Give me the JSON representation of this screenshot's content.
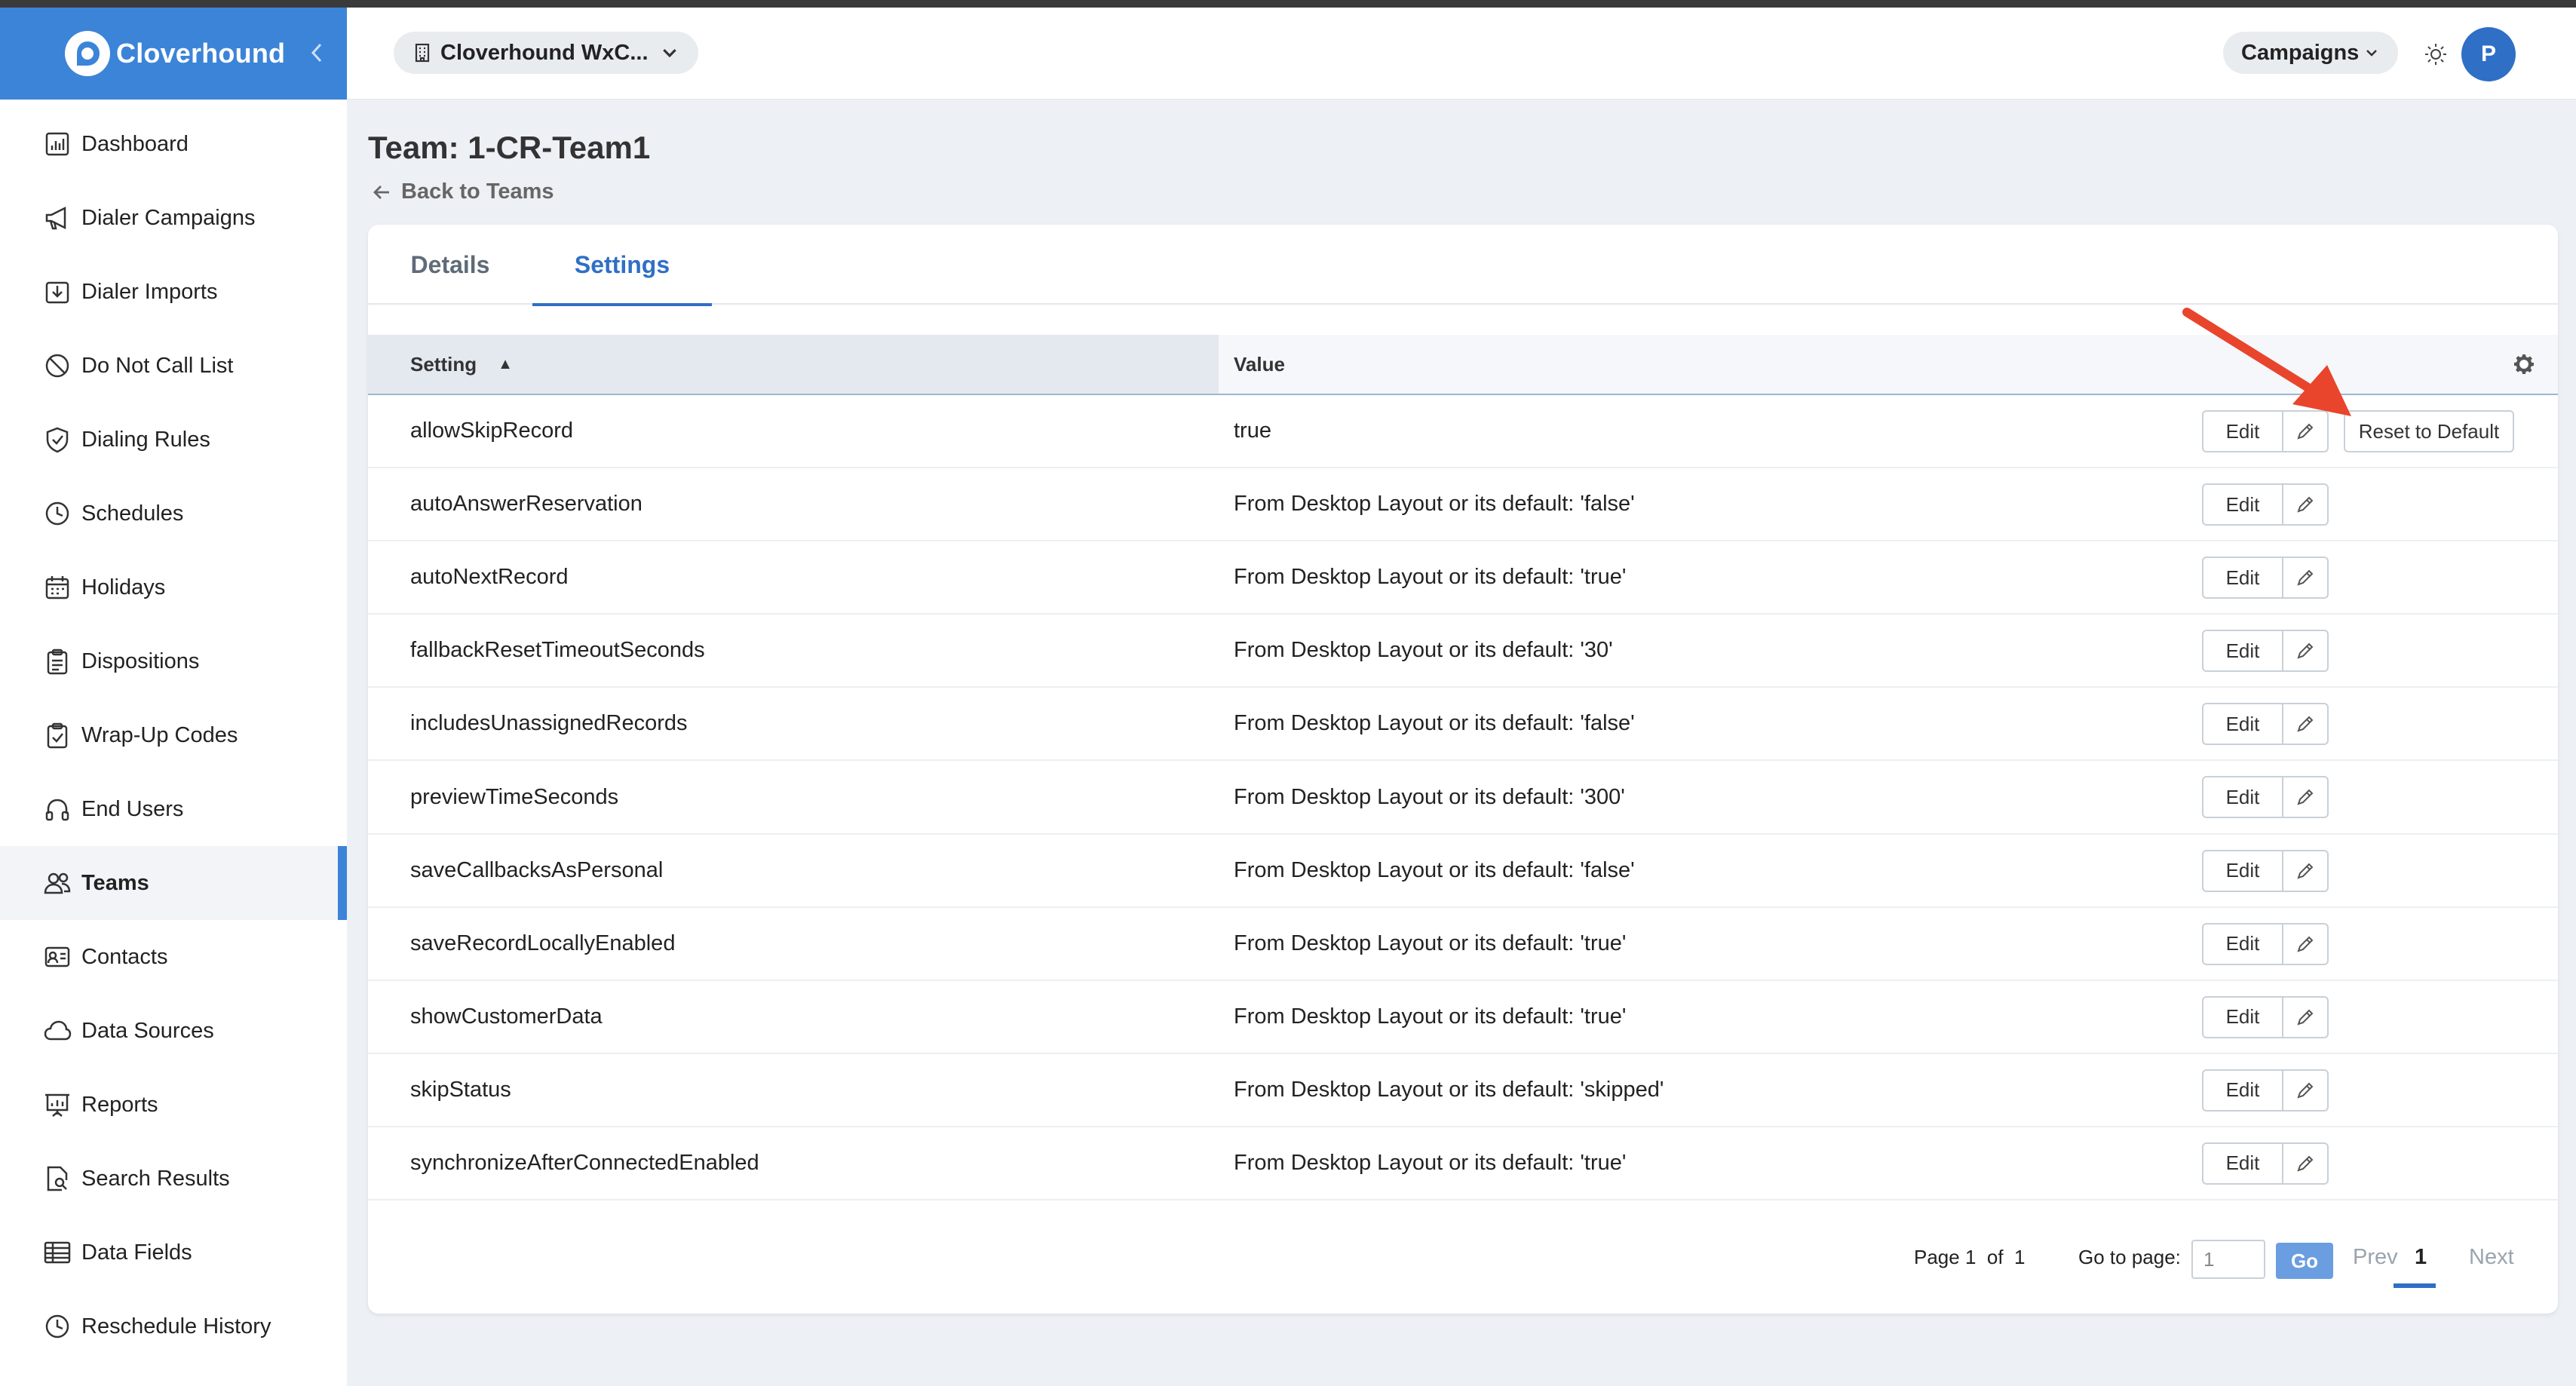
{
  "brand": {
    "name": "Cloverhound",
    "logo_icon": "clover-logo-icon",
    "color": "#3c84d8"
  },
  "sidebar": {
    "items": [
      {
        "label": "Dashboard",
        "icon": "chart-icon"
      },
      {
        "label": "Dialer Campaigns",
        "icon": "megaphone-icon"
      },
      {
        "label": "Dialer Imports",
        "icon": "import-icon"
      },
      {
        "label": "Do Not Call List",
        "icon": "ban-icon"
      },
      {
        "label": "Dialing Rules",
        "icon": "shield-check-icon"
      },
      {
        "label": "Schedules",
        "icon": "clock-icon"
      },
      {
        "label": "Holidays",
        "icon": "calendar-icon"
      },
      {
        "label": "Dispositions",
        "icon": "clipboard-icon"
      },
      {
        "label": "Wrap-Up Codes",
        "icon": "clipboard-check-icon"
      },
      {
        "label": "End Users",
        "icon": "headset-icon"
      },
      {
        "label": "Teams",
        "icon": "users-icon",
        "active": true
      },
      {
        "label": "Contacts",
        "icon": "contact-card-icon"
      },
      {
        "label": "Data Sources",
        "icon": "cloud-icon"
      },
      {
        "label": "Reports",
        "icon": "presentation-icon"
      },
      {
        "label": "Search Results",
        "icon": "search-doc-icon"
      },
      {
        "label": "Data Fields",
        "icon": "table-icon"
      },
      {
        "label": "Reschedule History",
        "icon": "clock-icon"
      }
    ]
  },
  "header": {
    "org_label": "Cloverhound WxC...",
    "campaigns_label": "Campaigns",
    "avatar_initial": "P"
  },
  "page": {
    "title": "Team: 1-CR-Team1",
    "back_label": "Back to Teams"
  },
  "tabs": [
    {
      "label": "Details",
      "active": false
    },
    {
      "label": "Settings",
      "active": true
    }
  ],
  "table": {
    "headers": {
      "setting": "Setting",
      "value": "Value",
      "sort_indicator": "▲"
    },
    "edit_label": "Edit",
    "reset_label": "Reset to Default",
    "rows": [
      {
        "setting": "allowSkipRecord",
        "value": "true",
        "has_reset": true
      },
      {
        "setting": "autoAnswerReservation",
        "value": "From Desktop Layout or its default: 'false'"
      },
      {
        "setting": "autoNextRecord",
        "value": "From Desktop Layout or its default: 'true'"
      },
      {
        "setting": "fallbackResetTimeoutSeconds",
        "value": "From Desktop Layout or its default: '30'"
      },
      {
        "setting": "includesUnassignedRecords",
        "value": "From Desktop Layout or its default: 'false'"
      },
      {
        "setting": "previewTimeSeconds",
        "value": "From Desktop Layout or its default: '300'"
      },
      {
        "setting": "saveCallbacksAsPersonal",
        "value": "From Desktop Layout or its default: 'false'"
      },
      {
        "setting": "saveRecordLocallyEnabled",
        "value": "From Desktop Layout or its default: 'true'"
      },
      {
        "setting": "showCustomerData",
        "value": "From Desktop Layout or its default: 'true'"
      },
      {
        "setting": "skipStatus",
        "value": "From Desktop Layout or its default: 'skipped'"
      },
      {
        "setting": "synchronizeAfterConnectedEnabled",
        "value": "From Desktop Layout or its default: 'true'"
      }
    ]
  },
  "pagination": {
    "page_word": "Page",
    "current": "1",
    "of_word": "of",
    "total": "1",
    "goto_label": "Go to page:",
    "goto_placeholder": "1",
    "go_label": "Go",
    "prev_label": "Prev",
    "next_label": "Next",
    "active_page": "1"
  },
  "colors": {
    "accent": "#2f6fc6",
    "annotation_arrow": "#e8452c"
  }
}
